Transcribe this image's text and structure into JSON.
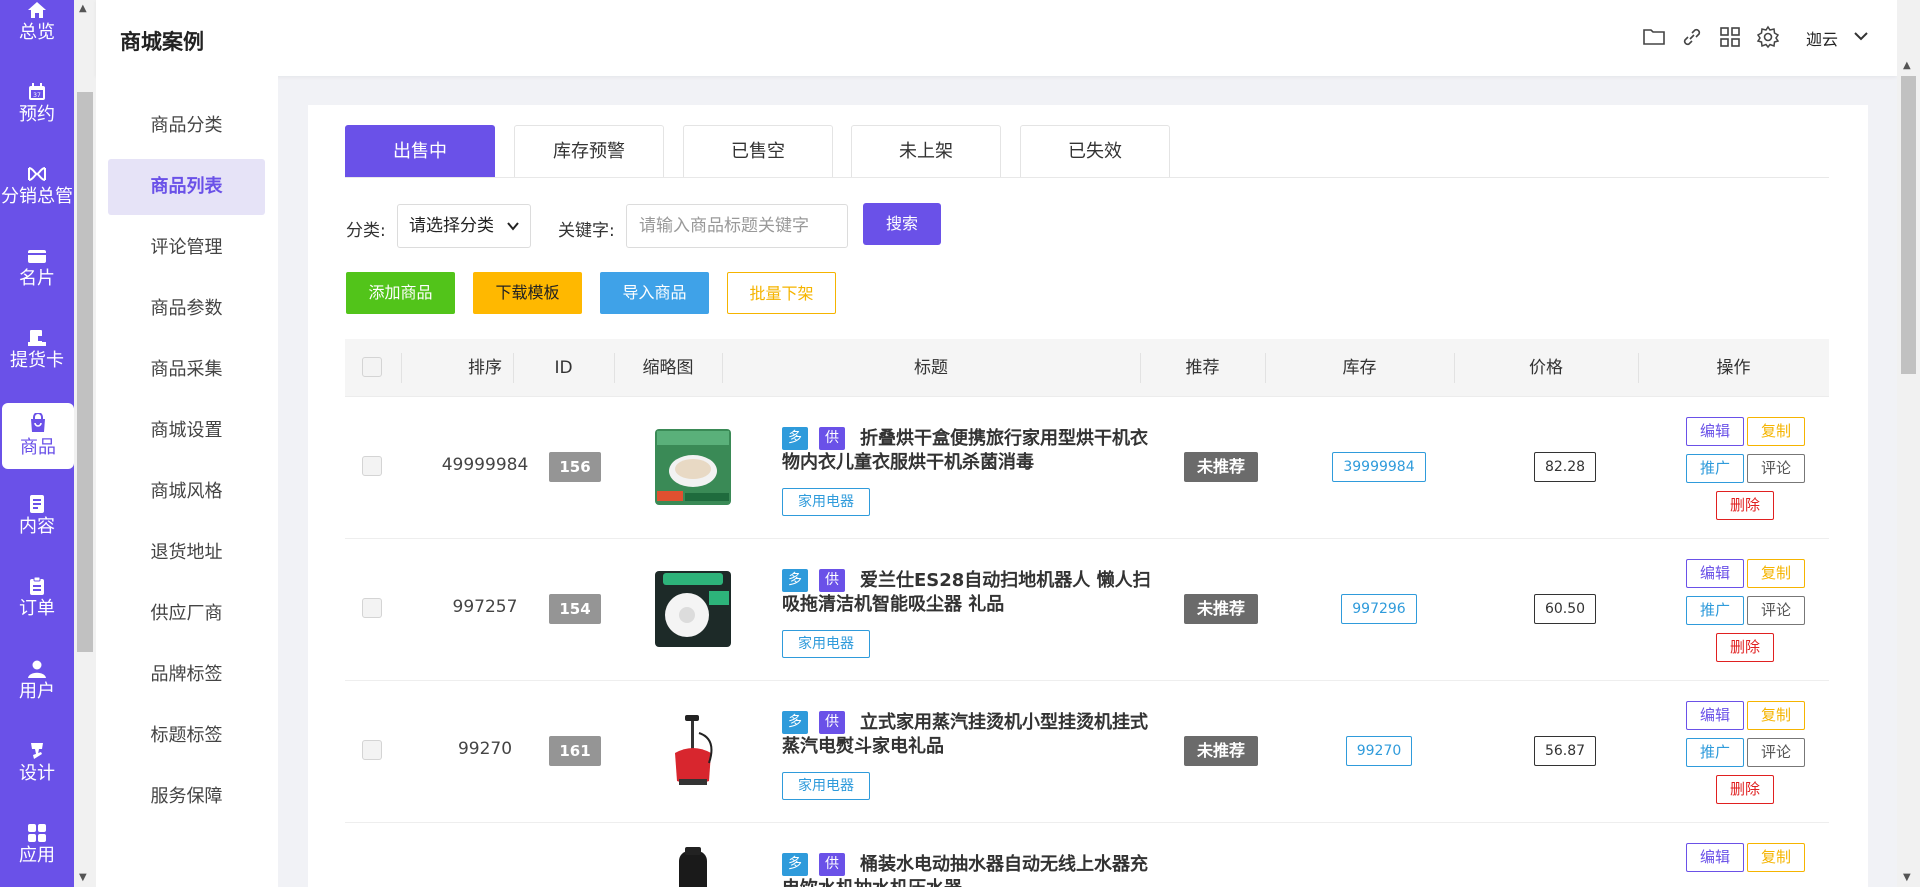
{
  "rail": {
    "items": [
      {
        "label": "总览",
        "icon": "home-icon"
      },
      {
        "label": "预约",
        "icon": "calendar-icon"
      },
      {
        "label": "分销总管",
        "icon": "distribution-icon"
      },
      {
        "label": "名片",
        "icon": "card-icon"
      },
      {
        "label": "提货卡",
        "icon": "voucher-icon"
      },
      {
        "label": "商品",
        "icon": "shopping-bag-icon"
      },
      {
        "label": "内容",
        "icon": "document-icon"
      },
      {
        "label": "订单",
        "icon": "clipboard-icon"
      },
      {
        "label": "用户",
        "icon": "user-icon"
      },
      {
        "label": "设计",
        "icon": "brush-icon"
      },
      {
        "label": "应用",
        "icon": "apps-icon"
      }
    ],
    "active_index": 5
  },
  "header": {
    "title": "商城案例",
    "icons": [
      "folder-icon",
      "link-icon",
      "grid-icon",
      "gear-icon"
    ],
    "user_name": "迦云"
  },
  "subnav": {
    "items": [
      "商品分类",
      "商品列表",
      "评论管理",
      "商品参数",
      "商品采集",
      "商城设置",
      "商城风格",
      "退货地址",
      "供应厂商",
      "品牌标签",
      "标题标签",
      "服务保障"
    ],
    "active_index": 1
  },
  "tabs": [
    "出售中",
    "库存预警",
    "已售空",
    "未上架",
    "已失效"
  ],
  "filter": {
    "category_label": "分类:",
    "category_value": "请选择分类",
    "keyword_label": "关键字:",
    "keyword_placeholder": "请输入商品标题关键字",
    "search_label": "搜索"
  },
  "actions": {
    "add": "添加商品",
    "download": "下载模板",
    "import": "导入商品",
    "batch_off": "批量下架"
  },
  "table": {
    "headers": [
      "排序",
      "ID",
      "缩略图",
      "标题",
      "推荐",
      "库存",
      "价格",
      "操作"
    ],
    "op_labels": {
      "edit": "编辑",
      "copy": "复制",
      "promote": "推广",
      "comment": "评论",
      "delete": "删除"
    },
    "tag_labels": {
      "duo": "多",
      "gong": "供"
    },
    "rows": [
      {
        "sort": "49999984",
        "id": "156",
        "title": "折叠烘干盒便携旅行家用型烘干机衣物内衣儿童衣服烘干机杀菌消毒",
        "category": "家用电器",
        "recommend": "未推荐",
        "stock": "39999984",
        "price": "82.28"
      },
      {
        "sort": "997257",
        "id": "154",
        "title": "爱兰仕ES28自动扫地机器人 懒人扫吸拖清洁机智能吸尘器 礼品",
        "category": "家用电器",
        "recommend": "未推荐",
        "stock": "997296",
        "price": "60.50"
      },
      {
        "sort": "99270",
        "id": "161",
        "title": "立式家用蒸汽挂烫机小型挂烫机挂式蒸汽电熨斗家电礼品",
        "category": "家用电器",
        "recommend": "未推荐",
        "stock": "99270",
        "price": "56.87"
      },
      {
        "sort": "",
        "id": "",
        "title": "桶装水电动抽水器自动无线上水器充电饮水机抽水机压水器",
        "category": "",
        "recommend": "",
        "stock": "",
        "price": ""
      }
    ]
  },
  "colors": {
    "accent": "#6a51e8",
    "blue": "#2f9bdb",
    "green": "#52c41a",
    "yellow": "#f5b400"
  }
}
